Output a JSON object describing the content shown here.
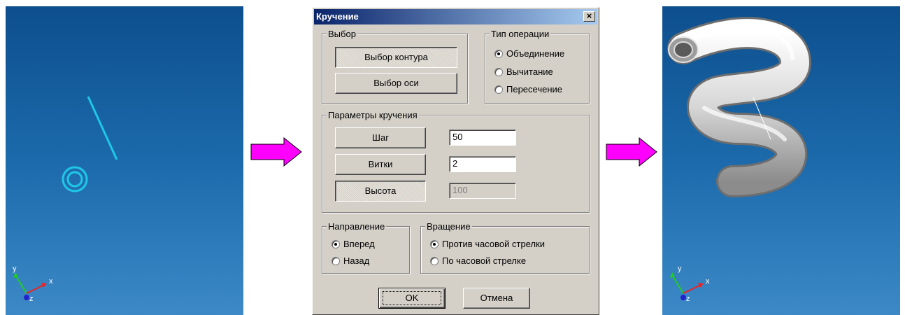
{
  "dialog": {
    "title": "Кручение",
    "close_label": "×",
    "selection_group": {
      "label": "Выбор",
      "contour_button": "Выбор контура",
      "axis_button": "Выбор оси"
    },
    "operation_group": {
      "label": "Тип операции",
      "options": [
        "Объединение",
        "Вычитание",
        "Пересечение"
      ],
      "selected": "Объединение"
    },
    "params_group": {
      "label": "Параметры кручения",
      "pitch_button": "Шаг",
      "pitch_value": "50",
      "turns_button": "Витки",
      "turns_value": "2",
      "height_button": "Высота",
      "height_value": "100"
    },
    "direction_group": {
      "label": "Направление",
      "options": [
        "Вперед",
        "Назад"
      ],
      "selected": "Вперед"
    },
    "rotation_group": {
      "label": "Вращение",
      "options": [
        "Против часовой стрелки",
        "По часовой стрелке"
      ],
      "selected": "Против часовой стрелки"
    },
    "ok_button": "OK",
    "cancel_button": "Отмена"
  },
  "viewports": {
    "axis_labels": {
      "x": "x",
      "y": "y",
      "z": "z"
    }
  },
  "colors": {
    "viewport_background": "#1c6aab",
    "profile_lines": "#1ec8e6",
    "arrow_fill": "#ff00ff",
    "title_bar": "#0a246a"
  }
}
